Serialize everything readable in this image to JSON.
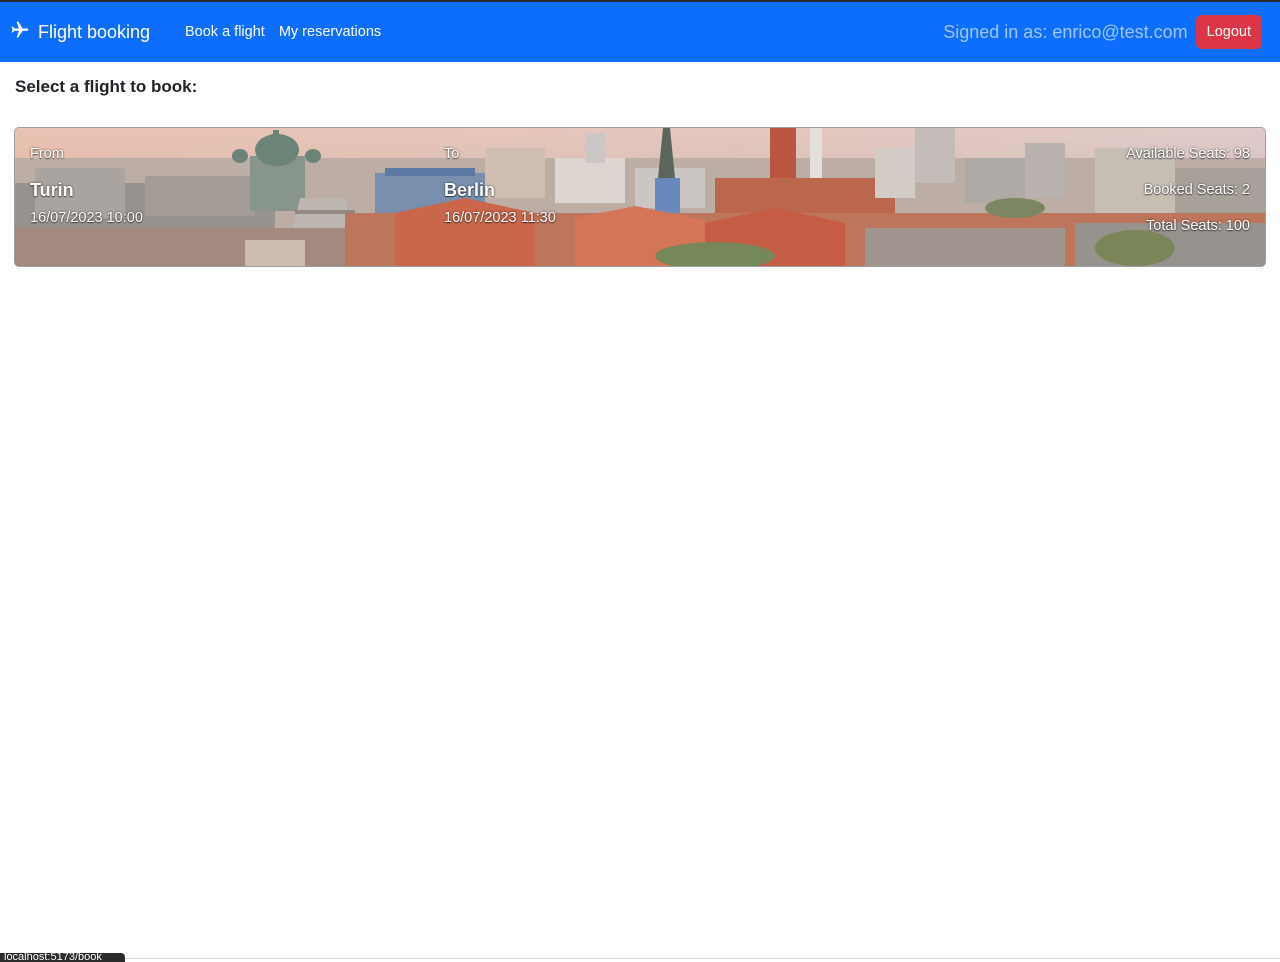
{
  "navbar": {
    "brand_label": "Flight booking",
    "brand_icon": "airplane-icon",
    "links": [
      {
        "label": "Book a flight"
      },
      {
        "label": "My reservations"
      }
    ],
    "signed_in_text": "Signed in as: enrico@test.com",
    "logout_label": "Logout",
    "colors": {
      "bar": "#0d6efd",
      "logout": "#dc3545",
      "signed_in_text": "#9ec5fe"
    }
  },
  "main": {
    "heading": "Select a flight to book:",
    "flights": [
      {
        "from_label": "From",
        "from_city": "Turin",
        "from_datetime": "16/07/2023 10:00",
        "to_label": "To",
        "to_city": "Berlin",
        "to_datetime": "16/07/2023 11:30",
        "available_seats": "Available Seats: 98",
        "booked_seats": "Booked Seats: 2",
        "total_seats": "Total Seats: 100",
        "background": "berlin-cityscape-image"
      }
    ]
  },
  "status_bar": {
    "url": "localhost:5173/book"
  }
}
